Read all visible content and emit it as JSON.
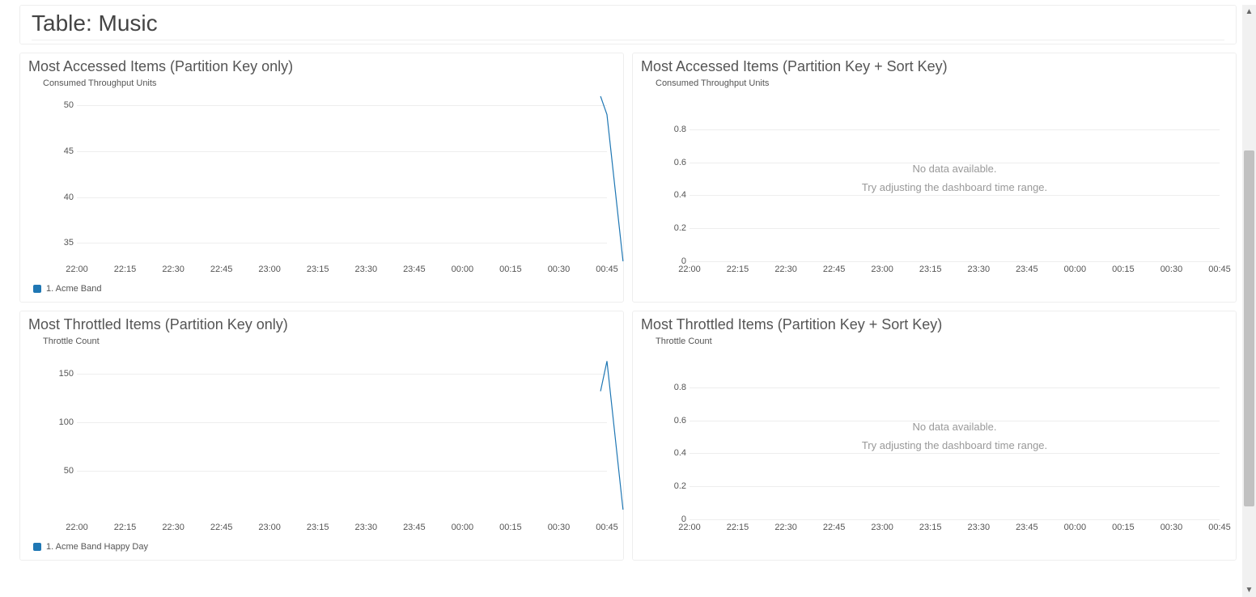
{
  "header": {
    "title": "Table: Music"
  },
  "x_categories": [
    "22:00",
    "22:15",
    "22:30",
    "22:45",
    "23:00",
    "23:15",
    "23:30",
    "23:45",
    "00:00",
    "00:15",
    "00:30",
    "00:45"
  ],
  "panels": [
    {
      "id": "accessed-pk",
      "title": "Most Accessed Items (Partition Key only)",
      "ylabel": "Consumed Throughput Units",
      "legend": "1. Acme Band",
      "empty": false,
      "yticks": [
        35,
        40,
        45,
        50
      ],
      "ylim": [
        33,
        51
      ]
    },
    {
      "id": "accessed-pk-sk",
      "title": "Most Accessed Items (Partition Key + Sort Key)",
      "ylabel": "Consumed Throughput Units",
      "legend": "",
      "empty": true,
      "empty_msg1": "No data available.",
      "empty_msg2": "Try adjusting the dashboard time range.",
      "yticks": [
        0,
        0.2,
        0.4,
        0.6,
        0.8
      ],
      "ylim": [
        0,
        1
      ]
    },
    {
      "id": "throttled-pk",
      "title": "Most Throttled Items (Partition Key only)",
      "ylabel": "Throttle Count",
      "legend": "1. Acme Band Happy Day",
      "empty": false,
      "yticks": [
        50,
        100,
        150
      ],
      "ylim": [
        0,
        170
      ]
    },
    {
      "id": "throttled-pk-sk",
      "title": "Most Throttled Items (Partition Key + Sort Key)",
      "ylabel": "Throttle Count",
      "legend": "",
      "empty": true,
      "empty_msg1": "No data available.",
      "empty_msg2": "Try adjusting the dashboard time range.",
      "yticks": [
        0,
        0.2,
        0.4,
        0.6,
        0.8
      ],
      "ylim": [
        0,
        1
      ]
    }
  ],
  "chart_data": [
    {
      "id": "accessed-pk",
      "type": "line",
      "xlabel": "",
      "ylabel": "Consumed Throughput Units",
      "title": "Most Accessed Items (Partition Key only)",
      "x": [
        "00:43",
        "00:45",
        "00:50"
      ],
      "series": [
        {
          "name": "1. Acme Band",
          "values": [
            51,
            49,
            33
          ]
        }
      ],
      "ylim": [
        33,
        51
      ]
    },
    {
      "id": "accessed-pk-sk",
      "type": "line",
      "xlabel": "",
      "ylabel": "Consumed Throughput Units",
      "title": "Most Accessed Items (Partition Key + Sort Key)",
      "x": [],
      "series": [],
      "ylim": [
        0,
        1
      ],
      "note": "No data available."
    },
    {
      "id": "throttled-pk",
      "type": "line",
      "xlabel": "",
      "ylabel": "Throttle Count",
      "title": "Most Throttled Items (Partition Key only)",
      "x": [
        "00:43",
        "00:45",
        "00:50"
      ],
      "series": [
        {
          "name": "1. Acme Band Happy Day",
          "values": [
            132,
            163,
            10
          ]
        }
      ],
      "ylim": [
        0,
        170
      ]
    },
    {
      "id": "throttled-pk-sk",
      "type": "line",
      "xlabel": "",
      "ylabel": "Throttle Count",
      "title": "Most Throttled Items (Partition Key + Sort Key)",
      "x": [],
      "series": [],
      "ylim": [
        0,
        1
      ],
      "note": "No data available."
    }
  ]
}
